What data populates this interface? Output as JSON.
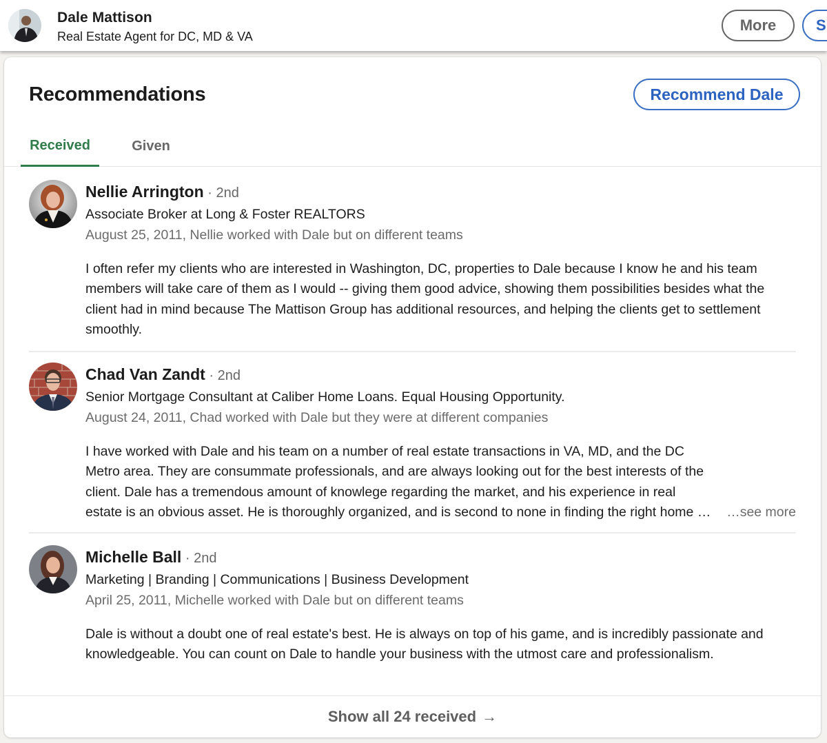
{
  "profile_header": {
    "name": "Dale Mattison",
    "headline": "Real Estate Agent for DC, MD & VA",
    "more_button": "More",
    "partial_button": "S"
  },
  "section": {
    "title": "Recommendations",
    "recommend_button": "Recommend Dale",
    "tabs": [
      {
        "label": "Received",
        "active": true
      },
      {
        "label": "Given",
        "active": false
      }
    ]
  },
  "recommendations": [
    {
      "name": "Nellie Arrington",
      "degree": " · 2nd",
      "headline": "Associate Broker at Long & Foster REALTORS",
      "meta": "August 25, 2011, Nellie worked with Dale but on different teams",
      "text": "I often refer my clients who are interested in Washington, DC, properties to Dale because I know he and his team members will take care of them as I would -- giving them good advice, showing them possibilities besides what the client had in mind because The Mattison Group has additional resources, and helping the clients get to settlement smoothly.",
      "avatar_icon": "person-photo-icon"
    },
    {
      "name": "Chad Van Zandt",
      "degree": " · 2nd",
      "headline": "Senior Mortgage Consultant at Caliber Home Loans. Equal Housing Opportunity.",
      "meta": "August 24, 2011, Chad worked with Dale but they were at different companies",
      "text": "I have worked with Dale and his team on a number of real estate transactions in VA, MD, and the DC Metro area. They are consummate professionals, and are always looking out for the best interests of the client. Dale has a tremendous amount of knowlege regarding the market, and his experience in real estate is an obvious asset. He is thoroughly organized, and is second to none in finding the right home for his",
      "see_more": "…see more",
      "avatar_icon": "person-photo-icon"
    },
    {
      "name": "Michelle Ball",
      "degree": " · 2nd",
      "headline": "Marketing | Branding | Communications | Business Development",
      "meta": "April 25, 2011, Michelle worked with Dale but on different teams",
      "text": "Dale is without a doubt one of real estate's best. He is always on top of his game, and is incredibly passionate and knowledgeable. You can count on Dale to handle your business with the utmost care and professionalism.",
      "avatar_icon": "person-photo-icon"
    }
  ],
  "footer": {
    "show_all": "Show all 24 received",
    "arrow_icon": "→"
  },
  "colors": {
    "accent_blue": "#2c62c0",
    "tab_active_green": "#2f7b4a",
    "muted_text": "#6b6b6b"
  }
}
